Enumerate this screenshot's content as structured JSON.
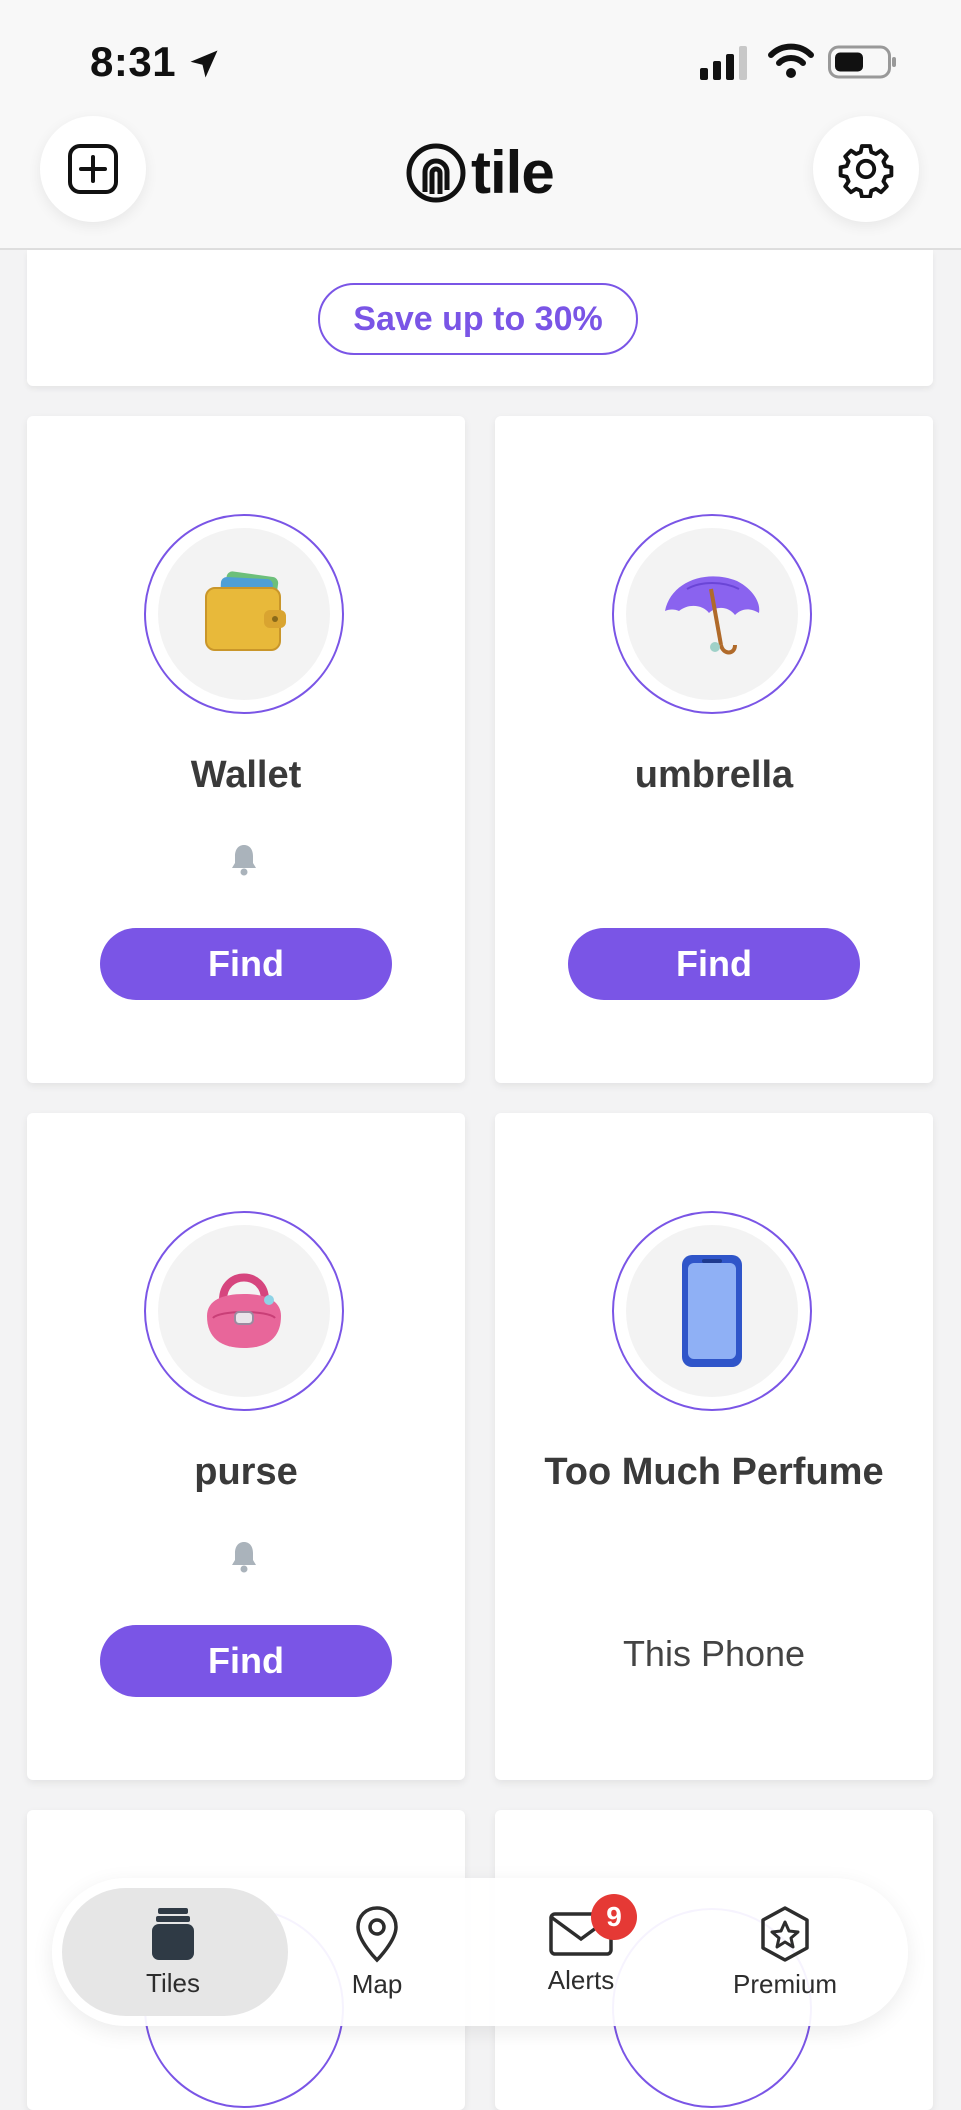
{
  "status_bar": {
    "time": "8:31"
  },
  "header": {
    "logo_text": "tile"
  },
  "promo": {
    "label": "Save up to 30%"
  },
  "tiles": [
    {
      "name": "Wallet",
      "action": "Find"
    },
    {
      "name": "umbrella",
      "action": "Find"
    },
    {
      "name": "purse",
      "action": "Find"
    },
    {
      "name": "Too Much Perfume",
      "subtext": "This Phone"
    }
  ],
  "tabbar": {
    "tabs": [
      {
        "label": "Tiles",
        "icon": "tiles-icon",
        "active": true
      },
      {
        "label": "Map",
        "icon": "map-pin-icon"
      },
      {
        "label": "Alerts",
        "icon": "mail-icon",
        "badge": "9"
      },
      {
        "label": "Premium",
        "icon": "premium-star-icon"
      }
    ]
  },
  "colors": {
    "accent": "#7a55e6",
    "badge": "#e53935",
    "background": "#f3f3f4"
  }
}
